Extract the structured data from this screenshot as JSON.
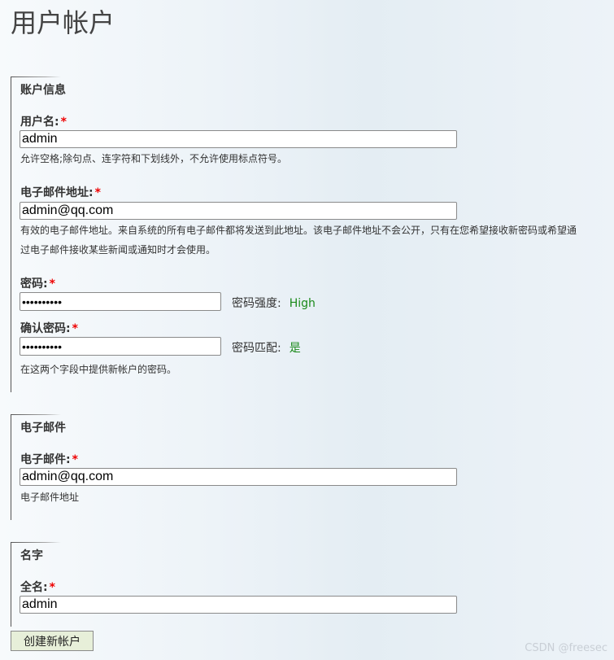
{
  "page": {
    "title": "用户帐户"
  },
  "account_info": {
    "legend": "账户信息",
    "username": {
      "label": "用户名:",
      "required": "*",
      "value": "admin",
      "description": "允许空格;除句点、连字符和下划线外，不允许使用标点符号。"
    },
    "email": {
      "label": "电子邮件地址:",
      "required": "*",
      "value": "admin@qq.com",
      "description_line1": "有效的电子邮件地址。来自系统的所有电子邮件都将发送到此地址。该电子邮件地址不会公开，只有在您希望接收新密码或希望通",
      "description_line2": "过电子邮件接收某些新闻或通知时才会使用。"
    },
    "password": {
      "label": "密码:",
      "required": "*",
      "masked_value": "••••••••••",
      "strength_label": "密码强度:",
      "strength_value": "High"
    },
    "confirm_password": {
      "label": "确认密码:",
      "required": "*",
      "masked_value": "••••••••••",
      "match_label": "密码匹配:",
      "match_value": "是"
    },
    "password_description": "在这两个字段中提供新帐户的密码。"
  },
  "email_section": {
    "legend": "电子邮件",
    "email": {
      "label": "电子邮件:",
      "required": "*",
      "value": "admin@qq.com",
      "description": "电子邮件地址"
    }
  },
  "name_section": {
    "legend": "名字",
    "fullname": {
      "label": "全名:",
      "required": "*",
      "value": "admin"
    }
  },
  "actions": {
    "submit_label": "创建新帐户"
  },
  "watermark": "CSDN @freesec",
  "colors": {
    "required": "#ee0000",
    "status_good": "#1a8a1a",
    "button_bg": "#e7efd9"
  }
}
